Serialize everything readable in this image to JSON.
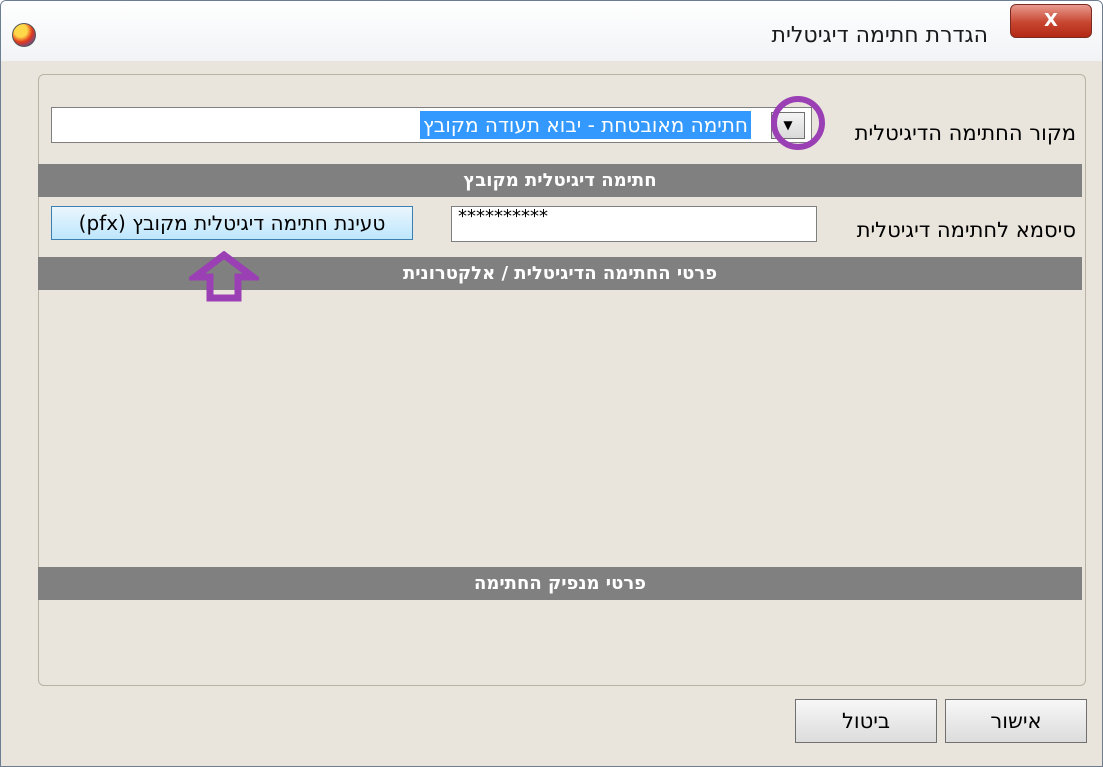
{
  "window": {
    "title": "הגדרת חתימה דיגיטלית",
    "close_label": "X"
  },
  "source": {
    "label": "מקור החתימה הדיגיטלית",
    "selected": "חתימה מאובטחת - יבוא תעודה מקובץ"
  },
  "sections": {
    "file_signature": "חתימה דיגיטלית מקובץ",
    "signature_details": "פרטי החתימה הדיגיטלית / אלקטרונית",
    "issuer_details": "פרטי מנפיק החתימה"
  },
  "password": {
    "label": "סיסמא לחתימה דיגיטלית",
    "value": "**********"
  },
  "load_button_label": "טעינת חתימה דיגיטלית מקובץ (pfx)",
  "buttons": {
    "ok": "אישור",
    "cancel": "ביטול"
  },
  "colors": {
    "annotation": "#9b3fb5",
    "selection": "#3399ff",
    "section_header": "#808080"
  }
}
